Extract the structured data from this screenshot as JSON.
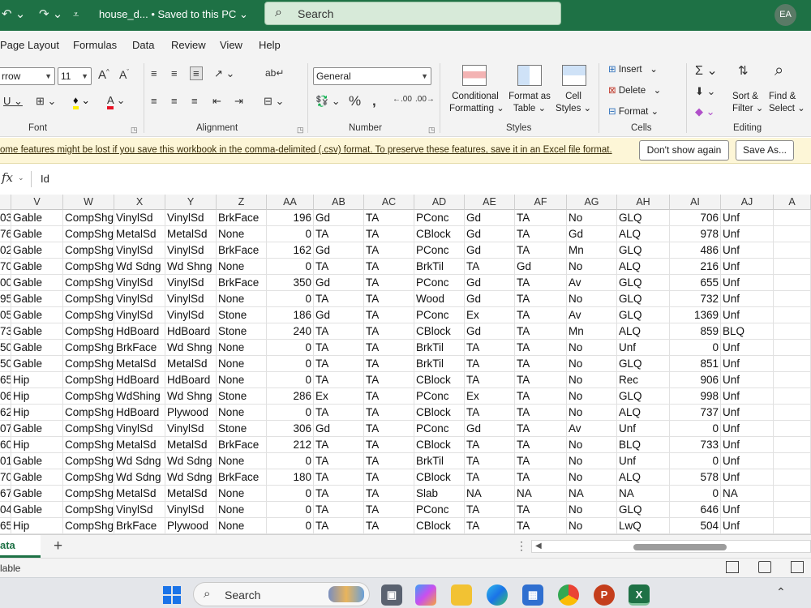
{
  "titlebar": {
    "doc_title": "house_d... • Saved to this PC",
    "search_label": "Search",
    "avatar_initials": "EA"
  },
  "tabs": [
    "Page Layout",
    "Formulas",
    "Data",
    "Review",
    "View",
    "Help"
  ],
  "ribbon": {
    "font_name": "rrow",
    "font_size": "11",
    "number_format": "General",
    "groups": {
      "font": "Font",
      "alignment": "Alignment",
      "number": "Number",
      "styles": "Styles",
      "cells": "Cells",
      "editing": "Editing"
    },
    "styles": {
      "conditional_1": "Conditional",
      "conditional_2": "Formatting",
      "format_as_1": "Format as",
      "format_as_2": "Table",
      "cell_1": "Cell",
      "cell_2": "Styles"
    },
    "cells": {
      "insert": "Insert",
      "delete": "Delete",
      "format": "Format"
    },
    "editing": {
      "sort_1": "Sort &",
      "sort_2": "Filter",
      "find_1": "Find &",
      "find_2": "Select"
    }
  },
  "message_bar": {
    "text": "ome features might be lost if you save this workbook in the comma-delimited (.csv) format. To preserve these features, save it in an Excel file format.",
    "dont_show": "Don't show again",
    "save_as": "Save As..."
  },
  "formula_bar": {
    "fx": "fx",
    "value": "Id"
  },
  "grid": {
    "columns": [
      "V",
      "W",
      "X",
      "Y",
      "Z",
      "AA",
      "AB",
      "AC",
      "AD",
      "AE",
      "AF",
      "AG",
      "AH",
      "AI",
      "AJ",
      "A"
    ],
    "rows": [
      [
        "03",
        "Gable",
        "CompShg",
        "VinylSd",
        "VinylSd",
        "BrkFace",
        "196",
        "Gd",
        "TA",
        "PConc",
        "Gd",
        "TA",
        "No",
        "GLQ",
        "706",
        "Unf"
      ],
      [
        "76",
        "Gable",
        "CompShg",
        "MetalSd",
        "MetalSd",
        "None",
        "0",
        "TA",
        "TA",
        "CBlock",
        "Gd",
        "TA",
        "Gd",
        "ALQ",
        "978",
        "Unf"
      ],
      [
        "02",
        "Gable",
        "CompShg",
        "VinylSd",
        "VinylSd",
        "BrkFace",
        "162",
        "Gd",
        "TA",
        "PConc",
        "Gd",
        "TA",
        "Mn",
        "GLQ",
        "486",
        "Unf"
      ],
      [
        "70",
        "Gable",
        "CompShg",
        "Wd Sdng",
        "Wd Shng",
        "None",
        "0",
        "TA",
        "TA",
        "BrkTil",
        "TA",
        "Gd",
        "No",
        "ALQ",
        "216",
        "Unf"
      ],
      [
        "00",
        "Gable",
        "CompShg",
        "VinylSd",
        "VinylSd",
        "BrkFace",
        "350",
        "Gd",
        "TA",
        "PConc",
        "Gd",
        "TA",
        "Av",
        "GLQ",
        "655",
        "Unf"
      ],
      [
        "95",
        "Gable",
        "CompShg",
        "VinylSd",
        "VinylSd",
        "None",
        "0",
        "TA",
        "TA",
        "Wood",
        "Gd",
        "TA",
        "No",
        "GLQ",
        "732",
        "Unf"
      ],
      [
        "05",
        "Gable",
        "CompShg",
        "VinylSd",
        "VinylSd",
        "Stone",
        "186",
        "Gd",
        "TA",
        "PConc",
        "Ex",
        "TA",
        "Av",
        "GLQ",
        "1369",
        "Unf"
      ],
      [
        "73",
        "Gable",
        "CompShg",
        "HdBoard",
        "HdBoard",
        "Stone",
        "240",
        "TA",
        "TA",
        "CBlock",
        "Gd",
        "TA",
        "Mn",
        "ALQ",
        "859",
        "BLQ"
      ],
      [
        "50",
        "Gable",
        "CompShg",
        "BrkFace",
        "Wd Shng",
        "None",
        "0",
        "TA",
        "TA",
        "BrkTil",
        "TA",
        "TA",
        "No",
        "Unf",
        "0",
        "Unf"
      ],
      [
        "50",
        "Gable",
        "CompShg",
        "MetalSd",
        "MetalSd",
        "None",
        "0",
        "TA",
        "TA",
        "BrkTil",
        "TA",
        "TA",
        "No",
        "GLQ",
        "851",
        "Unf"
      ],
      [
        "65",
        "Hip",
        "CompShg",
        "HdBoard",
        "HdBoard",
        "None",
        "0",
        "TA",
        "TA",
        "CBlock",
        "TA",
        "TA",
        "No",
        "Rec",
        "906",
        "Unf"
      ],
      [
        "06",
        "Hip",
        "CompShg",
        "WdShing",
        "Wd Shng",
        "Stone",
        "286",
        "Ex",
        "TA",
        "PConc",
        "Ex",
        "TA",
        "No",
        "GLQ",
        "998",
        "Unf"
      ],
      [
        "62",
        "Hip",
        "CompShg",
        "HdBoard",
        "Plywood",
        "None",
        "0",
        "TA",
        "TA",
        "CBlock",
        "TA",
        "TA",
        "No",
        "ALQ",
        "737",
        "Unf"
      ],
      [
        "07",
        "Gable",
        "CompShg",
        "VinylSd",
        "VinylSd",
        "Stone",
        "306",
        "Gd",
        "TA",
        "PConc",
        "Gd",
        "TA",
        "Av",
        "Unf",
        "0",
        "Unf"
      ],
      [
        "60",
        "Hip",
        "CompShg",
        "MetalSd",
        "MetalSd",
        "BrkFace",
        "212",
        "TA",
        "TA",
        "CBlock",
        "TA",
        "TA",
        "No",
        "BLQ",
        "733",
        "Unf"
      ],
      [
        "01",
        "Gable",
        "CompShg",
        "Wd Sdng",
        "Wd Sdng",
        "None",
        "0",
        "TA",
        "TA",
        "BrkTil",
        "TA",
        "TA",
        "No",
        "Unf",
        "0",
        "Unf"
      ],
      [
        "70",
        "Gable",
        "CompShg",
        "Wd Sdng",
        "Wd Sdng",
        "BrkFace",
        "180",
        "TA",
        "TA",
        "CBlock",
        "TA",
        "TA",
        "No",
        "ALQ",
        "578",
        "Unf"
      ],
      [
        "67",
        "Gable",
        "CompShg",
        "MetalSd",
        "MetalSd",
        "None",
        "0",
        "TA",
        "TA",
        "Slab",
        "NA",
        "NA",
        "NA",
        "NA",
        "0",
        "NA"
      ],
      [
        "04",
        "Gable",
        "CompShg",
        "VinylSd",
        "VinylSd",
        "None",
        "0",
        "TA",
        "TA",
        "PConc",
        "TA",
        "TA",
        "No",
        "GLQ",
        "646",
        "Unf"
      ],
      [
        "65",
        "Hip",
        "CompShg",
        "BrkFace",
        "Plywood",
        "None",
        "0",
        "TA",
        "TA",
        "CBlock",
        "TA",
        "TA",
        "No",
        "LwQ",
        "504",
        "Unf"
      ]
    ]
  },
  "sheet": {
    "tab_name": "ata",
    "add_icon": "plus-icon"
  },
  "status": {
    "text": "lable"
  },
  "taskbar": {
    "search_label": "Search"
  }
}
